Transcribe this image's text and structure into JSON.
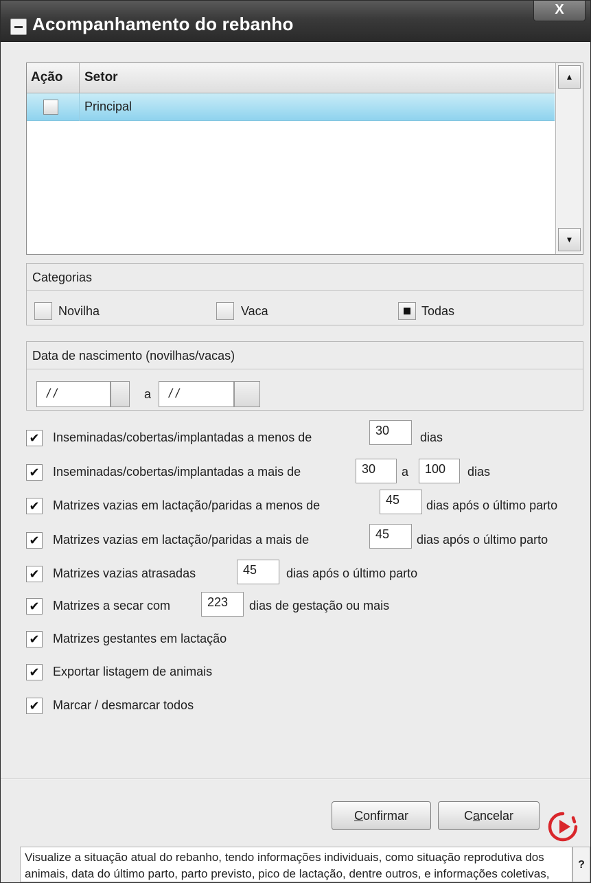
{
  "window": {
    "title": "Acompanhamento do rebanho",
    "close_label": "X"
  },
  "table": {
    "headers": {
      "acao": "Ação",
      "setor": "Setor"
    },
    "rows": [
      {
        "setor": "Principal"
      }
    ],
    "scroll_up": "▲",
    "scroll_down": "▼"
  },
  "categorias": {
    "title": "Categorias",
    "options": [
      {
        "label": "Novilha",
        "checked": false
      },
      {
        "label": "Vaca",
        "checked": false
      },
      {
        "label": "Todas",
        "checked": true
      }
    ]
  },
  "data_nascimento": {
    "title": "Data de nascimento (novilhas/vacas)",
    "from": "/ /",
    "separator": "a",
    "to": "/ /"
  },
  "options": {
    "opt1": {
      "label": "Inseminadas/cobertas/implantadas a menos de",
      "value": "30",
      "suffix": "dias"
    },
    "opt2": {
      "label": "Inseminadas/cobertas/implantadas a mais de",
      "value_from": "30",
      "between": "a",
      "value_to": "100",
      "suffix": "dias"
    },
    "opt3": {
      "label": "Matrizes vazias em lactação/paridas a menos de",
      "value": "45",
      "suffix": "dias após o último parto"
    },
    "opt4": {
      "label": "Matrizes vazias em lactação/paridas a mais de",
      "value": "45",
      "suffix": "dias após o último parto"
    },
    "opt5": {
      "label": "Matrizes vazias atrasadas",
      "value": "45",
      "suffix": "dias após o último parto"
    },
    "opt6": {
      "label": "Matrizes a secar com",
      "value": "223",
      "suffix": "dias de gestação ou mais"
    },
    "opt7": {
      "label": "Matrizes gestantes em lactação"
    },
    "opt8": {
      "label": "Exportar listagem de animais"
    },
    "opt9": {
      "label": "Marcar / desmarcar todos"
    },
    "check_mark": "✔"
  },
  "footer": {
    "confirm_mnemonic": "C",
    "confirm_rest": "onfirmar",
    "cancel_pre": "C",
    "cancel_mnemonic": "a",
    "cancel_rest": "ncelar",
    "help_text": "Visualize a situação atual do rebanho, tendo informações individuais, como situação reprodutiva dos animais, data do último parto, parto previsto, pico de lactação, dentre outros, e informações coletivas, como filtros de matrizes",
    "help_button": "?"
  },
  "colors": {
    "accent_red": "#d9262b",
    "selection_blue": "#8fd3ee"
  }
}
